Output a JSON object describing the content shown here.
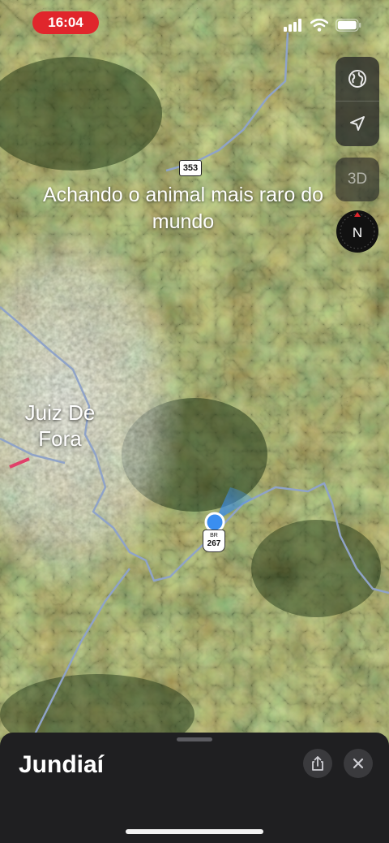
{
  "status_bar": {
    "time": "16:04"
  },
  "map": {
    "caption": "Achando o animal mais raro do mundo",
    "city_label": "Juiz De Fora",
    "route_shields": [
      {
        "label": "353"
      },
      {
        "prefix": "BR",
        "number": "267"
      }
    ],
    "route_color": "#8fa3c8",
    "location_color": "#3a8ef0"
  },
  "controls": {
    "map_mode_icon": "globe-icon",
    "locate_icon": "location-arrow-icon",
    "view_3d_label": "3D",
    "compass_label": "N"
  },
  "sheet": {
    "title": "Jundiaí",
    "share_icon": "share-icon",
    "close_icon": "close-icon"
  }
}
